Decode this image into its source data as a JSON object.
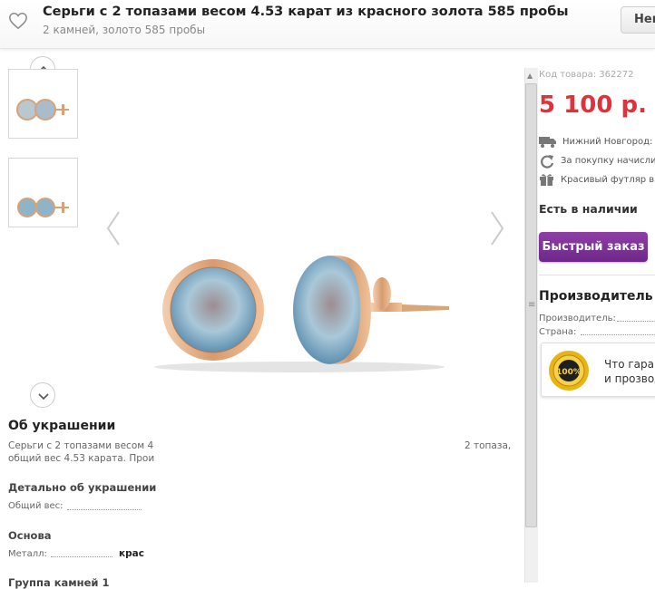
{
  "header": {
    "title": "Серьги с 2 топазами весом 4.53 карат из красного золота 585 пробы",
    "subtitle": "2 камней, золото 585 пробы",
    "button_label": "Нек"
  },
  "gallery": {
    "scroll_up_icon": "chevron-up-icon",
    "scroll_down_icon": "chevron-down-icon"
  },
  "about": {
    "heading": "Об украшении",
    "text_line1_start": "Серьги с 2 топазами весом 4",
    "text_line1_end": "2 топаза,",
    "text_line2": "общий вес 4.53 карата. Прои",
    "details_heading": "Детально об украшении",
    "total_weight_label": "Общий вес:",
    "base_heading": "Основа",
    "metal_label": "Металл:",
    "metal_value": "крас",
    "group_heading": "Группа камней 1"
  },
  "product": {
    "code": "Код товара: 362272",
    "price": "5 100 р.",
    "delivery": "Нижний Новгород: ч",
    "bonus": "За покупку начисли",
    "gift": "Красивый футляр в",
    "stock": "Есть в наличии",
    "quick_order": "Быстрый заказ",
    "maker_heading": "Производитель и",
    "maker_label": "Производитель:",
    "country_label": "Страна:",
    "guarantee_line1": "Что гаран",
    "guarantee_line2": "и прозвод",
    "badge_text": "100%"
  },
  "colors": {
    "price": "#e0313c",
    "button": "#7a2d93",
    "gold": "#d9a679",
    "topaz": "#9cc3d8"
  }
}
